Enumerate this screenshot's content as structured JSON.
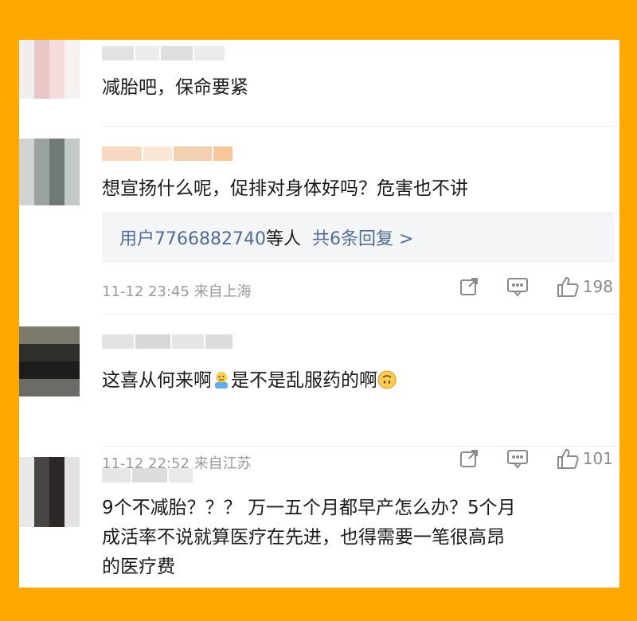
{
  "comments": [
    {
      "text": "减胎吧，保命要紧"
    },
    {
      "text": "想宣扬什么呢，促排对身体好吗？危害也不讲",
      "replies": {
        "users": "用户7766882740",
        "suffix": "等人",
        "count_text": "共6条回复 >"
      },
      "meta": "11-12 23:45  来自上海",
      "likes": "198",
      "icons": [
        "share-icon",
        "comment-icon",
        "like-icon"
      ]
    },
    {
      "text_part1": "这喜从何来啊",
      "text_part2": "是不是乱服药的啊",
      "emoji1": "shrug-emoji-icon",
      "emoji2": "upside-down-face-icon",
      "meta": "11-12 22:52  来自江苏",
      "likes": "101"
    },
    {
      "lines": [
        "9个不减胎？？？ 万一五个月都早产怎么办？5个月",
        "成活率不说就算医疗在先进，也得需要一笔很高昂",
        "的医疗费"
      ]
    }
  ],
  "colors": {
    "frame": "#FFA800",
    "link": "#4E6E97",
    "meta": "#9A9A9A"
  }
}
